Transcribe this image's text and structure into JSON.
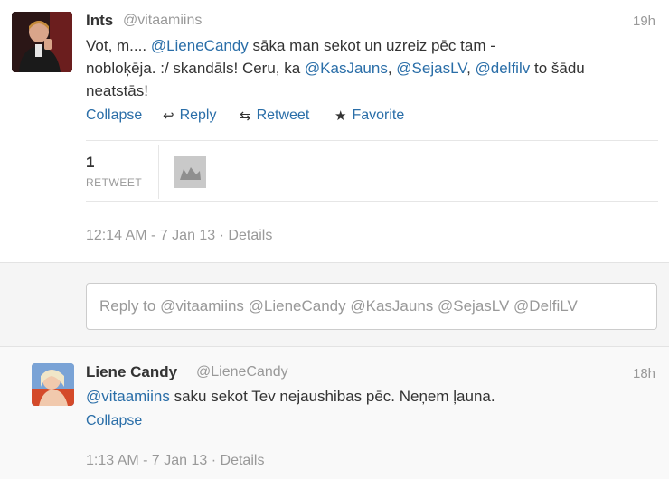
{
  "tweet1": {
    "name": "Ints",
    "handle": "@vitaamiins",
    "time": "19h",
    "line1_a": "Vot, m.... ",
    "line1_mention": "@LieneCandy",
    "line1_b": " sāka man sekot un uzreiz pēc tam -",
    "line2_a": "nobloķēja. :/ skandāls! Ceru, ka ",
    "line2_m1": "@KasJauns",
    "line2_sep1": ", ",
    "line2_m2": "@SejasLV",
    "line2_sep2": ", ",
    "line2_m3": "@delfilv",
    "line2_b": " to šādu",
    "line3": "neatstās!",
    "actions": {
      "collapse": "Collapse",
      "reply": "Reply",
      "retweet": "Retweet",
      "favorite": "Favorite"
    },
    "retweet_count": "1",
    "retweet_label": "RETWEET",
    "timestamp": "12:14 AM - 7 Jan 13",
    "details": "Details"
  },
  "reply": {
    "placeholder": "Reply to @vitaamiins @LieneCandy @KasJauns @SejasLV @DelfiLV"
  },
  "tweet2": {
    "name": "Liene Candy",
    "handle": "@LieneCandy",
    "time": "18h",
    "mention": "@vitaamiins",
    "text": " saku sekot Tev nejaushibas pēc. Neņem ļauna.",
    "collapse": "Collapse",
    "timestamp": "1:13 AM - 7 Jan 13",
    "details": "Details"
  },
  "separator": " · "
}
